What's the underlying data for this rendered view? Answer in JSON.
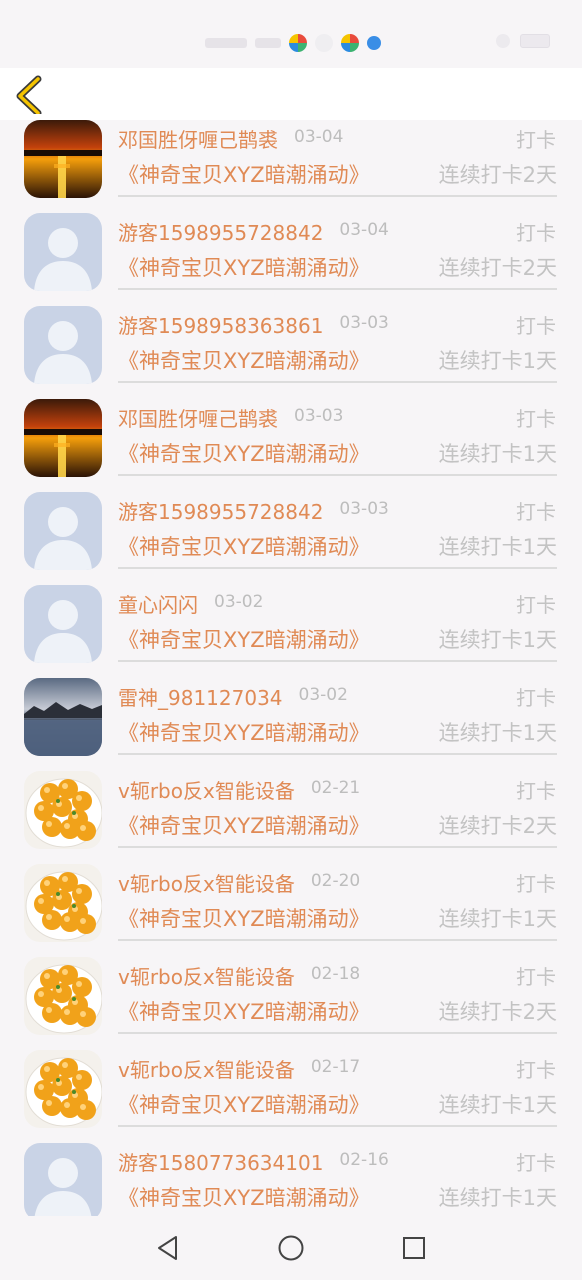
{
  "header": {
    "back_icon": "chevron-left-icon",
    "accent": "#f5c400"
  },
  "colors": {
    "name": "#e08a55",
    "muted": "#c3c3c3",
    "date": "#bdbdbd"
  },
  "items": [
    {
      "name": "邓国胜伢喱己鹊裘",
      "date": "03-04",
      "action": "打卡",
      "book": "《神奇宝贝XYZ暗潮涌动》",
      "streak": "连续打卡2天",
      "avatar": "sunset"
    },
    {
      "name": "游客1598955728842",
      "date": "03-04",
      "action": "打卡",
      "book": "《神奇宝贝XYZ暗潮涌动》",
      "streak": "连续打卡2天",
      "avatar": "default"
    },
    {
      "name": "游客1598958363861",
      "date": "03-03",
      "action": "打卡",
      "book": "《神奇宝贝XYZ暗潮涌动》",
      "streak": "连续打卡1天",
      "avatar": "default"
    },
    {
      "name": "邓国胜伢喱己鹊裘",
      "date": "03-03",
      "action": "打卡",
      "book": "《神奇宝贝XYZ暗潮涌动》",
      "streak": "连续打卡1天",
      "avatar": "sunset"
    },
    {
      "name": "游客1598955728842",
      "date": "03-03",
      "action": "打卡",
      "book": "《神奇宝贝XYZ暗潮涌动》",
      "streak": "连续打卡1天",
      "avatar": "default"
    },
    {
      "name": "童心闪闪",
      "date": "03-02",
      "action": "打卡",
      "book": "《神奇宝贝XYZ暗潮涌动》",
      "streak": "连续打卡1天",
      "avatar": "default"
    },
    {
      "name": "雷神_981127034",
      "date": "03-02",
      "action": "打卡",
      "book": "《神奇宝贝XYZ暗潮涌动》",
      "streak": "连续打卡1天",
      "avatar": "lake"
    },
    {
      "name": "v轭rbo反x智能设备",
      "date": "02-21",
      "action": "打卡",
      "book": "《神奇宝贝XYZ暗潮涌动》",
      "streak": "连续打卡2天",
      "avatar": "food"
    },
    {
      "name": "v轭rbo反x智能设备",
      "date": "02-20",
      "action": "打卡",
      "book": "《神奇宝贝XYZ暗潮涌动》",
      "streak": "连续打卡1天",
      "avatar": "food"
    },
    {
      "name": "v轭rbo反x智能设备",
      "date": "02-18",
      "action": "打卡",
      "book": "《神奇宝贝XYZ暗潮涌动》",
      "streak": "连续打卡2天",
      "avatar": "food"
    },
    {
      "name": "v轭rbo反x智能设备",
      "date": "02-17",
      "action": "打卡",
      "book": "《神奇宝贝XYZ暗潮涌动》",
      "streak": "连续打卡1天",
      "avatar": "food"
    },
    {
      "name": "游客1580773634101",
      "date": "02-16",
      "action": "打卡",
      "book": "《神奇宝贝XYZ暗潮涌动》",
      "streak": "连续打卡1天",
      "avatar": "default"
    }
  ],
  "navbar": {
    "back": "triangle-back-icon",
    "home": "circle-home-icon",
    "recents": "square-recents-icon"
  }
}
